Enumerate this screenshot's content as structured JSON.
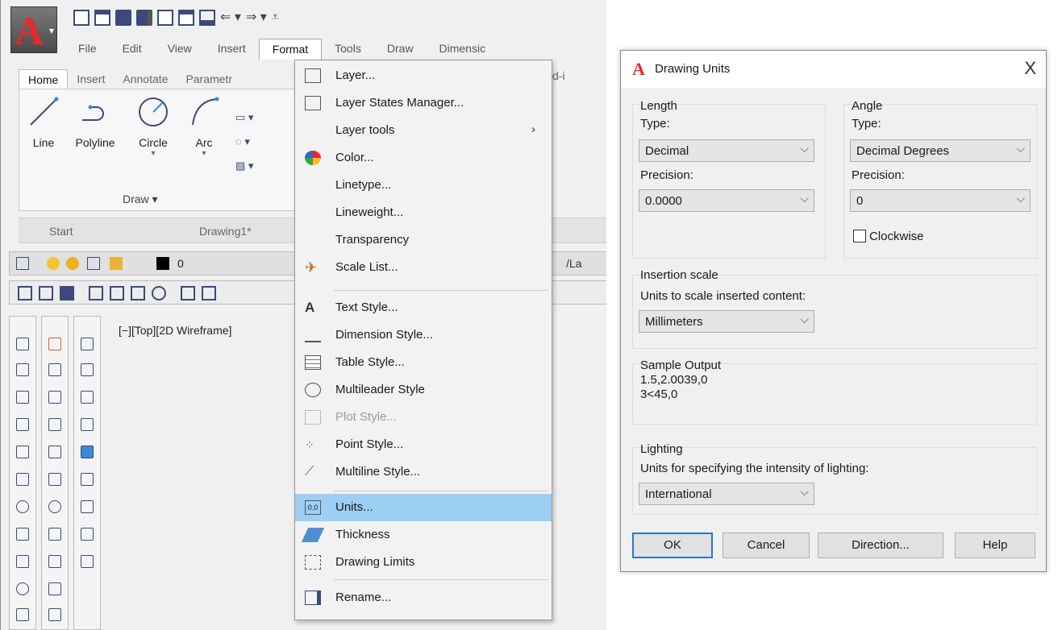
{
  "app": {
    "logo_letter": "A",
    "menubar": [
      "File",
      "Edit",
      "View",
      "Insert",
      "Format",
      "Tools",
      "Draw",
      "Dimensic"
    ],
    "ribbon_tabs": [
      "Home",
      "Insert",
      "Annotate",
      "Parametr"
    ],
    "draw_tools": [
      "Line",
      "Polyline",
      "Circle",
      "Arc"
    ],
    "draw_panel_label": "Draw ▾",
    "doc_tabs": {
      "start": "Start",
      "drawing": "Drawing1*"
    },
    "layer_value": "0",
    "layer_right_text": "/La",
    "viewport_label": "[−][Top][2D Wireframe]",
    "right_fragment": "d-i"
  },
  "format_menu": {
    "items": [
      {
        "label": "Layer...",
        "icon": "layer-icon"
      },
      {
        "label": "Layer States Manager...",
        "icon": "layer-states-icon"
      },
      {
        "label": "Layer tools",
        "submenu": "›"
      },
      {
        "label": "Color...",
        "icon": "color-wheel-icon"
      },
      {
        "label": "Linetype..."
      },
      {
        "label": "Lineweight..."
      },
      {
        "label": "Transparency"
      },
      {
        "label": "Scale List...",
        "icon": "scale-list-icon"
      },
      {
        "label": "Text Style...",
        "icon": "text-style-icon"
      },
      {
        "label": "Dimension Style...",
        "icon": "dimension-style-icon"
      },
      {
        "label": "Table Style...",
        "icon": "table-style-icon"
      },
      {
        "label": "Multileader Style",
        "icon": "multileader-icon"
      },
      {
        "label": "Plot Style...",
        "icon": "plot-style-icon",
        "disabled": true
      },
      {
        "label": "Point Style...",
        "icon": "point-style-icon"
      },
      {
        "label": "Multiline Style...",
        "icon": "multiline-icon"
      },
      {
        "label": "Units...",
        "icon": "units-icon",
        "icon_text": "0.0",
        "highlighted": true
      },
      {
        "label": "Thickness",
        "icon": "thickness-icon"
      },
      {
        "label": "Drawing Limits",
        "icon": "limits-icon"
      },
      {
        "label": "Rename...",
        "icon": "rename-icon"
      }
    ]
  },
  "dialog": {
    "title": "Drawing Units",
    "close": "X",
    "length": {
      "group": "Length",
      "type_label": "Type:",
      "type_value": "Decimal",
      "precision_label": "Precision:",
      "precision_value": "0.0000"
    },
    "angle": {
      "group": "Angle",
      "type_label": "Type:",
      "type_value": "Decimal Degrees",
      "precision_label": "Precision:",
      "precision_value": "0",
      "clockwise_label": "Clockwise"
    },
    "insertion": {
      "group": "Insertion scale",
      "label": "Units to scale inserted content:",
      "value": "Millimeters"
    },
    "sample": {
      "group": "Sample Output",
      "line1": "1.5,2.0039,0",
      "line2": "3<45,0"
    },
    "lighting": {
      "group": "Lighting",
      "label": "Units for specifying the intensity of lighting:",
      "value": "International"
    },
    "buttons": {
      "ok": "OK",
      "cancel": "Cancel",
      "direction": "Direction...",
      "help": "Help"
    },
    "chevron": "⌵"
  }
}
